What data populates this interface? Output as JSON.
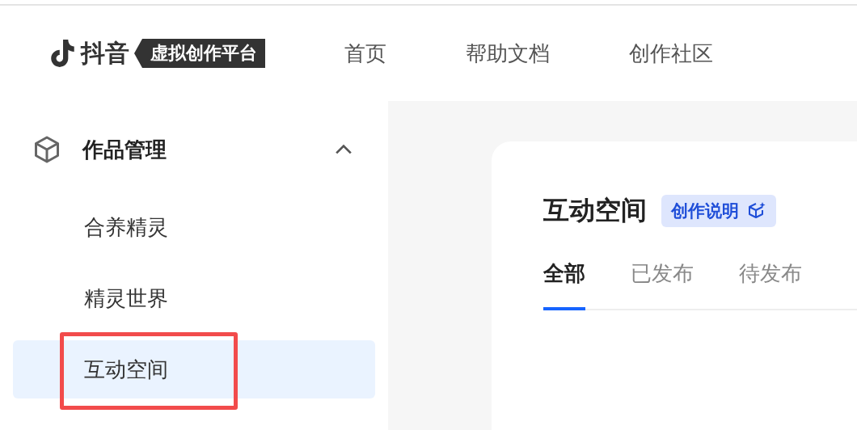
{
  "header": {
    "brand": "抖音",
    "product": "虚拟创作平台",
    "nav": [
      {
        "label": "首页",
        "selected": false
      },
      {
        "label": "帮助文档",
        "selected": false
      },
      {
        "label": "创作社区",
        "selected": false
      }
    ]
  },
  "sidebar": {
    "group": {
      "label": "作品管理",
      "expanded": true,
      "children": [
        {
          "label": "合养精灵",
          "selected": false,
          "highlighted": false
        },
        {
          "label": "精灵世界",
          "selected": false,
          "highlighted": false
        },
        {
          "label": "互动空间",
          "selected": true,
          "highlighted": true
        }
      ]
    }
  },
  "content": {
    "title": "互动空间",
    "guide_button": "创作说明",
    "tabs": [
      {
        "label": "全部",
        "selected": true
      },
      {
        "label": "已发布",
        "selected": false
      },
      {
        "label": "待发布",
        "selected": false
      }
    ]
  }
}
